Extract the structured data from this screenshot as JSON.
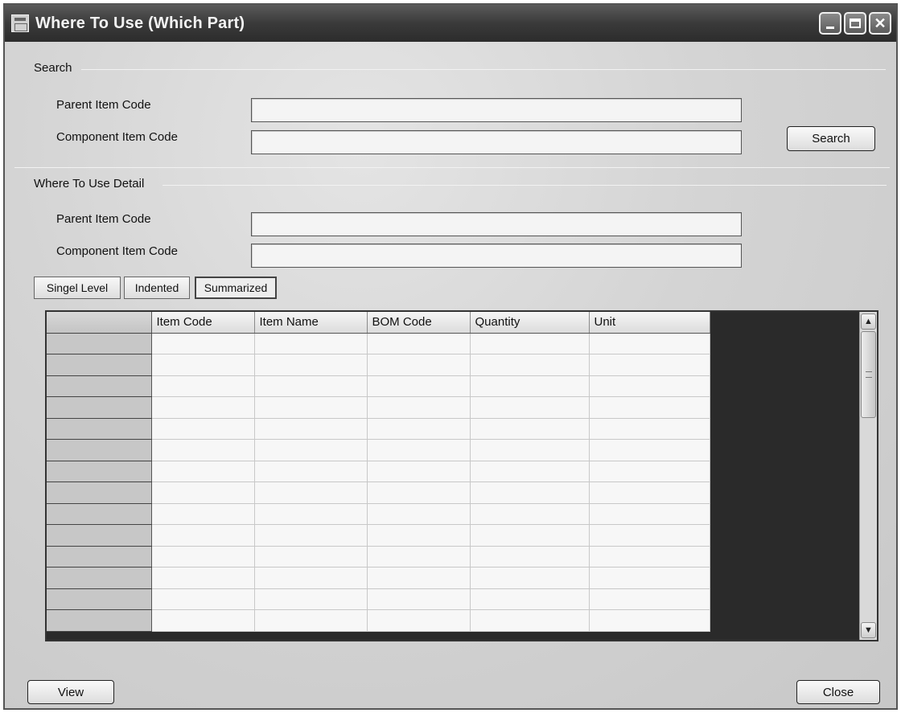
{
  "window": {
    "title": "Where To Use (Which Part)"
  },
  "search_section": {
    "label": "Search",
    "parent_item_code_label": "Parent Item Code",
    "parent_item_code_value": "",
    "component_item_code_label": "Component Item Code",
    "component_item_code_value": "",
    "search_button": "Search"
  },
  "detail_section": {
    "label": "Where To Use Detail",
    "parent_item_code_label": "Parent Item Code",
    "parent_item_code_value": "",
    "component_item_code_label": "Component Item Code",
    "component_item_code_value": ""
  },
  "view_tabs": {
    "items": [
      "Singel Level",
      "Indented",
      "Summarized"
    ],
    "active": "Summarized"
  },
  "grid": {
    "columns": [
      "Item Code",
      "Item Name",
      "BOM Code",
      "Quantity",
      "Unit"
    ],
    "row_count": 14,
    "rows": []
  },
  "footer": {
    "view_button": "View",
    "close_button": "Close"
  },
  "icons": {
    "app": "form-window-icon",
    "minimize": "minimize-icon",
    "maximize": "maximize-icon",
    "close": "close-icon",
    "scroll_up": "scroll-up-icon",
    "scroll_down": "scroll-down-icon"
  }
}
